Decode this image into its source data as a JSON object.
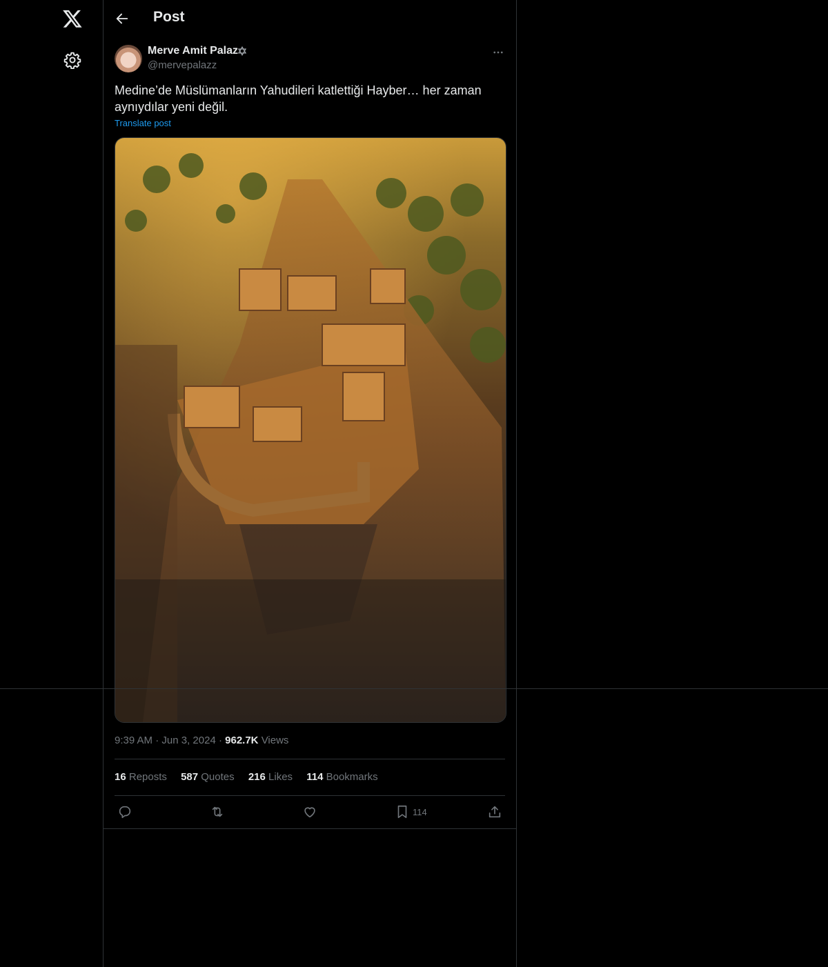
{
  "header": {
    "title": "Post"
  },
  "author": {
    "name": "Merve Amit Palaz",
    "handle": "@mervepalazz"
  },
  "post": {
    "text": "Medine’de Müslümanların Yahudileri katlettiği Hayber… her zaman aynıydılar yeni değil.",
    "translate_label": "Translate post",
    "time": "9:39 AM",
    "date": "Jun 3, 2024",
    "views_count": "962.7K",
    "views_label": "Views"
  },
  "stats": {
    "reposts_count": "16",
    "reposts_label": "Reposts",
    "quotes_count": "587",
    "quotes_label": "Quotes",
    "likes_count": "216",
    "likes_label": "Likes",
    "bookmarks_count": "114",
    "bookmarks_label": "Bookmarks"
  },
  "actions": {
    "bookmark_count": "114"
  },
  "icons": {
    "logo": "x-logo-icon",
    "settings": "gear-icon",
    "back": "arrow-left-icon",
    "verified": "star-of-david-icon",
    "more": "more-horizontal-icon",
    "reply": "reply-icon",
    "repost": "repost-icon",
    "like": "heart-icon",
    "bookmark": "bookmark-icon",
    "share": "share-icon"
  },
  "colors": {
    "background": "#000000",
    "text": "#e7e9ea",
    "muted": "#71767b",
    "link": "#1d9bf0",
    "border": "#2f3336"
  }
}
